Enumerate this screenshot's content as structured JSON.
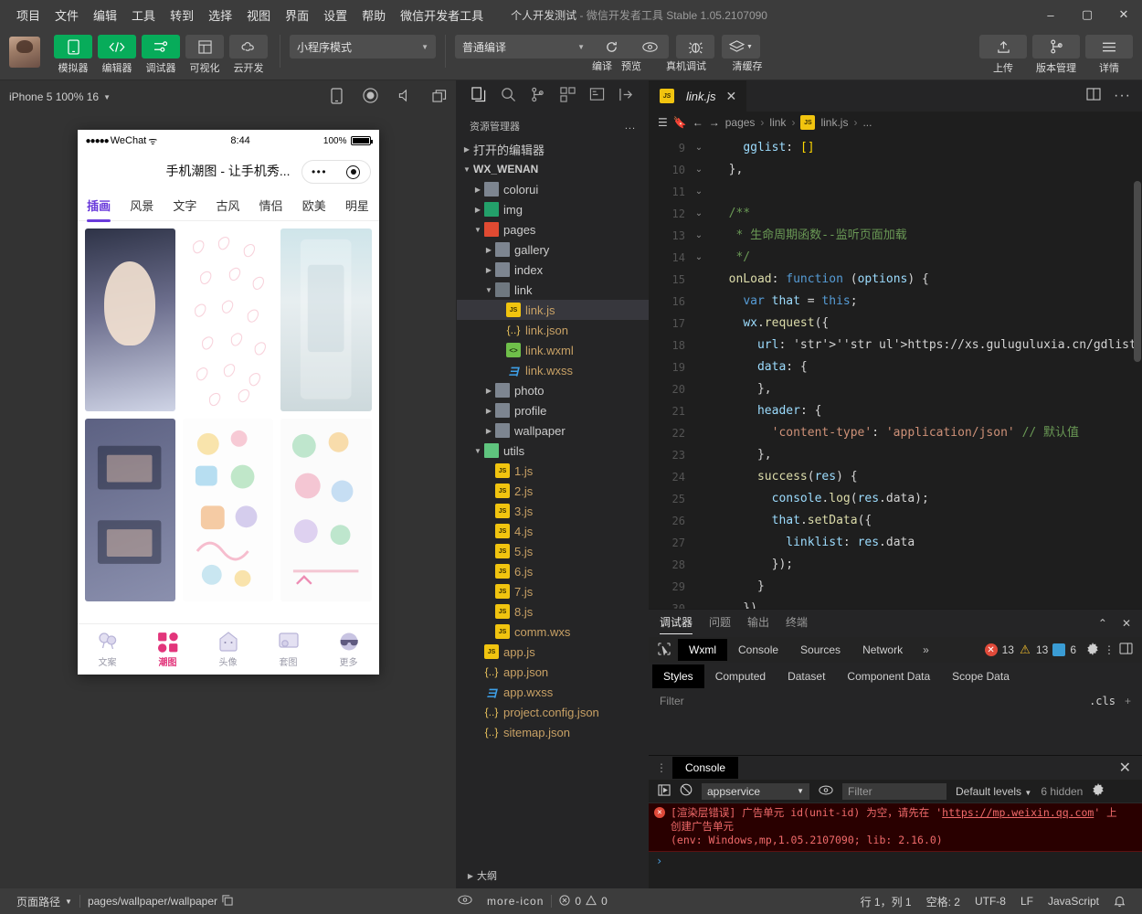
{
  "titlebar": {
    "menus": [
      "项目",
      "文件",
      "编辑",
      "工具",
      "转到",
      "选择",
      "视图",
      "界面",
      "设置",
      "帮助",
      "微信开发者工具"
    ],
    "project": "个人开发测试",
    "app_title": "- 微信开发者工具 Stable 1.05.2107090",
    "minimize": "–",
    "maximize": "▢",
    "close": "✕"
  },
  "toolbar": {
    "buttons": [
      {
        "label": "模拟器",
        "icon": "phone-icon",
        "active": true
      },
      {
        "label": "编辑器",
        "icon": "code-icon",
        "active": true
      },
      {
        "label": "调试器",
        "icon": "sliders-icon",
        "active": true
      },
      {
        "label": "可视化",
        "icon": "layout-icon",
        "active": false
      },
      {
        "label": "云开发",
        "icon": "cloud-icon",
        "active": false
      }
    ],
    "mode_select": "小程序模式",
    "compile_select": "普通编译",
    "actions": [
      {
        "label": "编译",
        "icon": "refresh-icon"
      },
      {
        "label": "预览",
        "icon": "eye-icon"
      },
      {
        "label": "真机调试",
        "icon": "bug-icon"
      },
      {
        "label": "清缓存",
        "icon": "layers-icon"
      }
    ],
    "right_actions": [
      {
        "label": "上传",
        "icon": "upload-icon"
      },
      {
        "label": "版本管理",
        "icon": "branch-icon"
      },
      {
        "label": "详情",
        "icon": "menu-icon"
      }
    ]
  },
  "simulator": {
    "device": "iPhone 5 100% 16",
    "toolbar_icons": [
      "phone-rotate-icon",
      "record-icon",
      "mute-icon",
      "window-icon"
    ],
    "phone": {
      "carrier": "WeChat",
      "signal_dots": "●●●●●",
      "wifi": "ᯤ",
      "time": "8:44",
      "battery_pct": "100%",
      "nav_title": "手机潮图 - 让手机秀...",
      "capsule_dots": "•••",
      "tabs": [
        "插画",
        "风景",
        "文字",
        "古风",
        "情侣",
        "欧美",
        "明星"
      ],
      "active_tab": "插画",
      "tabbar": [
        {
          "label": "文案",
          "icon": "balloon-icon",
          "active": false
        },
        {
          "label": "潮图",
          "icon": "grid-icon",
          "active": true
        },
        {
          "label": "头像",
          "icon": "ghost-icon",
          "active": false
        },
        {
          "label": "套图",
          "icon": "album-icon",
          "active": false
        },
        {
          "label": "更多",
          "icon": "sunglasses-icon",
          "active": false
        }
      ]
    }
  },
  "explorer": {
    "activity_icons": [
      "files-icon",
      "search-icon",
      "source-control-icon",
      "extensions-icon",
      "test-icon",
      "collapse-icon"
    ],
    "title": "资源管理器",
    "more": "...",
    "open_editors": "打开的编辑器",
    "project_root": "WX_WENAN",
    "tree": [
      {
        "label": "colorui",
        "type": "folder",
        "depth": 1,
        "expanded": false
      },
      {
        "label": "img",
        "type": "folder-green",
        "depth": 1,
        "expanded": false
      },
      {
        "label": "pages",
        "type": "folder-red",
        "depth": 1,
        "expanded": true
      },
      {
        "label": "gallery",
        "type": "folder",
        "depth": 2,
        "expanded": false
      },
      {
        "label": "index",
        "type": "folder",
        "depth": 2,
        "expanded": false
      },
      {
        "label": "link",
        "type": "folder-open",
        "depth": 2,
        "expanded": true
      },
      {
        "label": "link.js",
        "type": "js",
        "depth": 3,
        "selected": true
      },
      {
        "label": "link.json",
        "type": "json",
        "depth": 3
      },
      {
        "label": "link.wxml",
        "type": "wxml",
        "depth": 3
      },
      {
        "label": "link.wxss",
        "type": "wxss",
        "depth": 3
      },
      {
        "label": "photo",
        "type": "folder",
        "depth": 2,
        "expanded": false
      },
      {
        "label": "profile",
        "type": "folder",
        "depth": 2,
        "expanded": false
      },
      {
        "label": "wallpaper",
        "type": "folder",
        "depth": 2,
        "expanded": false
      },
      {
        "label": "utils",
        "type": "folder-lightgreen",
        "depth": 1,
        "expanded": true
      },
      {
        "label": "1.js",
        "type": "js",
        "depth": 2
      },
      {
        "label": "2.js",
        "type": "js",
        "depth": 2
      },
      {
        "label": "3.js",
        "type": "js",
        "depth": 2
      },
      {
        "label": "4.js",
        "type": "js",
        "depth": 2
      },
      {
        "label": "5.js",
        "type": "js",
        "depth": 2
      },
      {
        "label": "6.js",
        "type": "js",
        "depth": 2
      },
      {
        "label": "7.js",
        "type": "js",
        "depth": 2
      },
      {
        "label": "8.js",
        "type": "js",
        "depth": 2
      },
      {
        "label": "comm.wxs",
        "type": "js",
        "depth": 2
      },
      {
        "label": "app.js",
        "type": "js",
        "depth": 1
      },
      {
        "label": "app.json",
        "type": "json",
        "depth": 1
      },
      {
        "label": "app.wxss",
        "type": "wxss",
        "depth": 1
      },
      {
        "label": "project.config.json",
        "type": "json",
        "depth": 1
      },
      {
        "label": "sitemap.json",
        "type": "json",
        "depth": 1
      }
    ],
    "outline": "大纲"
  },
  "editor": {
    "tab_label": "link.js",
    "tab_close": "✕",
    "split_icon": "split-editor-icon",
    "more_icon": "more-icon",
    "breadcrumb": [
      "pages",
      "link",
      "link.js",
      "..."
    ],
    "first_line_no": 9,
    "lines": [
      {
        "n": 9,
        "fold": "",
        "text": "    gglist: []"
      },
      {
        "n": 10,
        "fold": "",
        "text": "  },"
      },
      {
        "n": 11,
        "fold": "",
        "text": ""
      },
      {
        "n": 12,
        "fold": "v",
        "text": "  /**"
      },
      {
        "n": 13,
        "fold": "",
        "text": "   * 生命周期函数--监听页面加载"
      },
      {
        "n": 14,
        "fold": "",
        "text": "   */"
      },
      {
        "n": 15,
        "fold": "v",
        "text": "  onLoad: function (options) {"
      },
      {
        "n": 16,
        "fold": "",
        "text": "    var that = this;"
      },
      {
        "n": 17,
        "fold": "v",
        "text": "    wx.request({"
      },
      {
        "n": 18,
        "fold": "",
        "text": "      url: 'https://xs.guluguluxia.cn/gdlist.php',"
      },
      {
        "n": 19,
        "fold": "",
        "text": "      data: {"
      },
      {
        "n": 20,
        "fold": "",
        "text": "      },"
      },
      {
        "n": 21,
        "fold": "v",
        "text": "      header: {"
      },
      {
        "n": 22,
        "fold": "",
        "text": "        'content-type': 'application/json' // 默认值"
      },
      {
        "n": 23,
        "fold": "",
        "text": "      },"
      },
      {
        "n": 24,
        "fold": "v",
        "text": "      success(res) {"
      },
      {
        "n": 25,
        "fold": "",
        "text": "        console.log(res.data);"
      },
      {
        "n": 26,
        "fold": "v",
        "text": "        that.setData({"
      },
      {
        "n": 27,
        "fold": "",
        "text": "          linklist: res.data"
      },
      {
        "n": 28,
        "fold": "",
        "text": "        });"
      },
      {
        "n": 29,
        "fold": "",
        "text": "      }"
      },
      {
        "n": 30,
        "fold": "",
        "text": "    })"
      }
    ]
  },
  "debugger": {
    "panel_tabs": [
      "调试器",
      "问题",
      "输出",
      "终端"
    ],
    "panel_active": "调试器",
    "collapse_icon": "chevron-up-icon",
    "close_icon": "close-icon",
    "inspect_icon": "inspect-icon",
    "devtool_tabs": [
      "Wxml",
      "Console",
      "Sources",
      "Network"
    ],
    "devtool_active": "Wxml",
    "overflow": "»",
    "counts": {
      "errors": "13",
      "warnings": "13",
      "info": "6"
    },
    "gear_icon": "gear-icon",
    "kebab_icon": "kebab-icon",
    "dock_icon": "dock-icon",
    "style_tabs": [
      "Styles",
      "Computed",
      "Dataset",
      "Component Data",
      "Scope Data"
    ],
    "style_active": "Styles",
    "filter_placeholder": "Filter",
    "cls_label": ".cls",
    "plus": "+"
  },
  "console": {
    "title": "Console",
    "close": "✕",
    "drag_icon": "drag-handle-icon",
    "run_icon": "execute-icon",
    "clear_icon": "clear-icon",
    "context": "appservice",
    "eye_icon": "eye-icon",
    "filter_placeholder": "Filter",
    "levels": "Default levels",
    "hidden": "6 hidden",
    "settings_icon": "gear-icon",
    "error_line1_a": "[渲染层错误] 广告单元 id(unit-id) 为空，请先在 ",
    "error_link": "https://mp.weixin.qq.com",
    "error_line1_b": " 上",
    "error_line2": "创建广告单元",
    "error_line3": "(env: Windows,mp,1.05.2107090; lib: 2.16.0)",
    "prompt": "›"
  },
  "statusbar": {
    "page_path_label": "页面路径",
    "page_path": "pages/wallpaper/wallpaper",
    "copy_icon": "copy-icon",
    "eye_icon": "eye-icon",
    "more_icon": "more-icon",
    "errors": "0",
    "warnings": "0",
    "cursor": "行 1，列 1",
    "spaces": "空格: 2",
    "encoding": "UTF-8",
    "eol": "LF",
    "language": "JavaScript",
    "bell_icon": "bell-icon"
  },
  "colors": {
    "accent_green": "#07ac5a",
    "tab_purple": "#6a3bdb",
    "error_red": "#e04a3a",
    "warn_yellow": "#f0bd2d"
  }
}
